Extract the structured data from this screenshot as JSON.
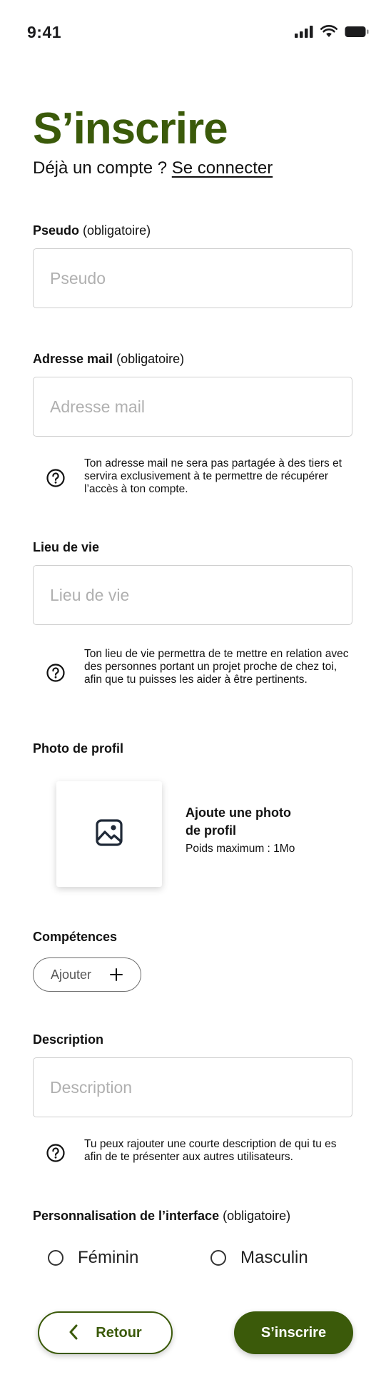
{
  "status_bar": {
    "time": "9:41",
    "icons": [
      "cellular-signal-icon",
      "wifi-icon",
      "battery-icon"
    ]
  },
  "header": {
    "title": "S’inscrire",
    "login_prompt": "Déjà un compte ?",
    "login_link": "Se connecter"
  },
  "fields": {
    "pseudo": {
      "label": "Pseudo",
      "required_note": "(obligatoire)",
      "placeholder": "Pseudo",
      "value": ""
    },
    "email": {
      "label": "Adresse mail",
      "required_note": "(obligatoire)",
      "placeholder": "Adresse mail",
      "value": "",
      "help_icon": "question-circle-icon",
      "help": "Ton adresse mail ne sera pas partagée à des tiers et servira exclusivement à te permettre de récupérer l’accès à ton compte."
    },
    "location": {
      "label": "Lieu de vie",
      "placeholder": "Lieu de vie",
      "value": "",
      "help_icon": "question-circle-icon",
      "help": "Ton lieu de vie permettra de te mettre en relation avec des personnes portant un projet proche de chez toi, afin que tu puisses les aider à être pertinents."
    },
    "photo": {
      "label": "Photo de profil",
      "icon": "image-icon",
      "title": "Ajoute une photo de profil",
      "note": "Poids maximum : 1Mo"
    },
    "skills": {
      "label": "Compétences",
      "add_label": "Ajouter",
      "add_icon": "plus-icon"
    },
    "description": {
      "label": "Description",
      "placeholder": "Description",
      "value": "",
      "help_icon": "question-circle-icon",
      "help": "Tu peux rajouter une courte description de qui tu es afin de te présenter aux autres utilisateurs."
    },
    "interface": {
      "label": "Personnalisation de l’interface",
      "required_note": "(obligatoire)",
      "options": [
        {
          "label": "Féminin",
          "selected": false
        },
        {
          "label": "Masculin",
          "selected": false
        }
      ]
    }
  },
  "actions": {
    "back_label": "Retour",
    "back_icon": "chevron-left-icon",
    "submit_label": "S’inscrire"
  },
  "colors": {
    "brand_green": "#3b5a0a",
    "placeholder_gray": "#b0b0b0",
    "input_border": "#cfcfcf"
  }
}
